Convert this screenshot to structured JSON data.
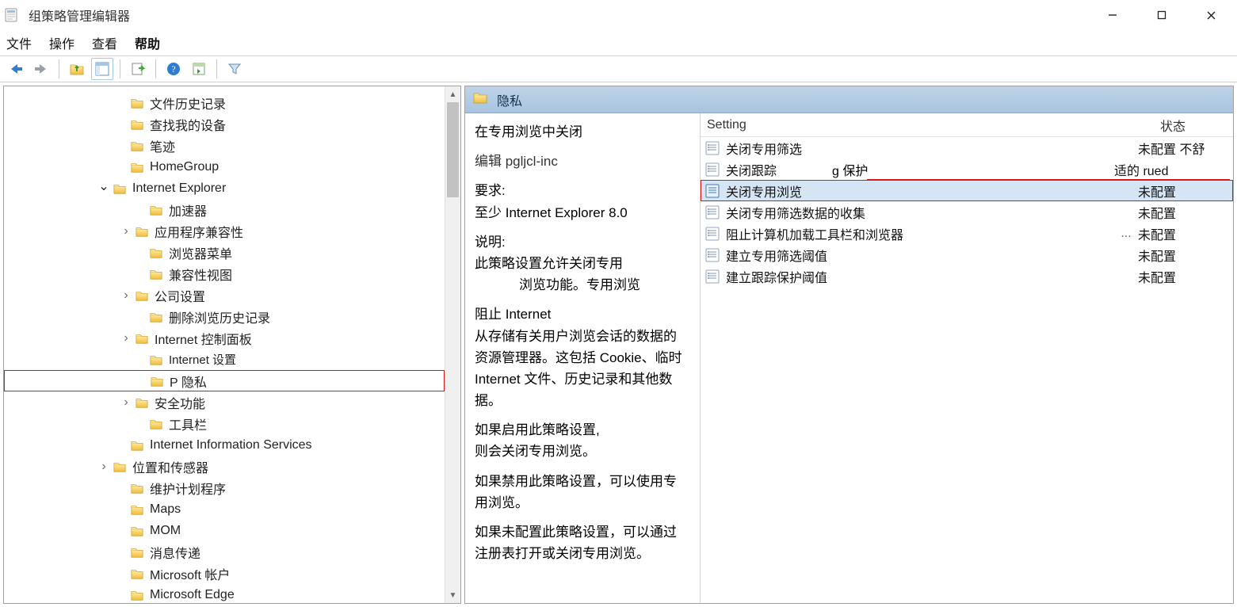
{
  "window": {
    "title": "组策略管理编辑器"
  },
  "menu": {
    "file": "文件",
    "action": "操作",
    "view": "查看",
    "help": "帮助"
  },
  "tree": {
    "items": [
      {
        "indent": 140,
        "expander": "",
        "label": "文件历史记录"
      },
      {
        "indent": 140,
        "expander": "",
        "label": "查找我的设备"
      },
      {
        "indent": 140,
        "expander": "",
        "label": "笔迹"
      },
      {
        "indent": 140,
        "expander": "",
        "label": "HomeGroup"
      },
      {
        "indent": 118,
        "expander": "v",
        "label": "Internet Explorer"
      },
      {
        "indent": 164,
        "expander": "",
        "label": "加速器"
      },
      {
        "indent": 146,
        "expander": ">",
        "label": "应用程序兼容性"
      },
      {
        "indent": 164,
        "expander": "",
        "label": "浏览器菜单"
      },
      {
        "indent": 164,
        "expander": "",
        "label": "兼容性视图"
      },
      {
        "indent": 146,
        "expander": ">",
        "label": "公司设置"
      },
      {
        "indent": 164,
        "expander": "",
        "label": "删除浏览历史记录"
      },
      {
        "indent": 146,
        "expander": ">",
        "label": "Internet 控制面板"
      },
      {
        "indent": 164,
        "expander": "",
        "label": "Internet 设置",
        "small": true
      },
      {
        "indent": 164,
        "expander": "",
        "label": "P 隐私",
        "highlight": true
      },
      {
        "indent": 146,
        "expander": ">",
        "label": "安全功能"
      },
      {
        "indent": 164,
        "expander": "",
        "label": "工具栏"
      },
      {
        "indent": 140,
        "expander": "",
        "label": "Internet Information Services"
      },
      {
        "indent": 118,
        "expander": ">",
        "label": "位置和传感器"
      },
      {
        "indent": 140,
        "expander": "",
        "label": "维护计划程序"
      },
      {
        "indent": 140,
        "expander": "",
        "label": "Maps"
      },
      {
        "indent": 140,
        "expander": "",
        "label": "MOM"
      },
      {
        "indent": 140,
        "expander": "",
        "label": "消息传递"
      },
      {
        "indent": 140,
        "expander": "",
        "label": "Microsoft 帐户"
      },
      {
        "indent": 140,
        "expander": "",
        "label": "Microsoft Edge"
      }
    ]
  },
  "right": {
    "header_title": "隐私",
    "columns": {
      "setting": "Setting",
      "state": "状态"
    },
    "details": {
      "title": "在专用浏览中关闭",
      "edit_line": "编辑 pgljcl-inc",
      "req_label": "要求:",
      "req_value": "至少 Internet Explorer 8.0",
      "desc_label": "说明:",
      "p1": "此策略设置允许关闭专用",
      "p1b": "浏览功能。专用浏览",
      "p2": "阻止 Internet",
      "p3": "从存储有关用户浏览会话的数据的资源管理器。这包括 Cookie、临时 Internet 文件、历史记录和其他数据。",
      "p4": "如果启用此策略设置,",
      "p4b": "则会关闭专用浏览。",
      "p5": "如果禁用此策略设置，可以使用专用浏览。",
      "p6": "如果未配置此策略设置，可以通过注册表打开或关闭专用浏览。"
    },
    "settings": [
      {
        "name": "关闭专用筛选",
        "state": "未配置 不舒",
        "icon": "policy"
      },
      {
        "name": "关闭跟踪",
        "state": "适的 rued",
        "icon": "policy",
        "mid": "g 保护",
        "redline": true
      },
      {
        "name": "关闭专用浏览",
        "state": "未配置",
        "icon": "policy-sel",
        "selected": true,
        "highlight": true
      },
      {
        "name": "关闭专用筛选数据的收集",
        "state": "未配置",
        "icon": "policy"
      },
      {
        "name": "阻止计算机加载工具栏和浏览器",
        "state": "未配置",
        "icon": "policy",
        "ellipsis": "..."
      },
      {
        "name": "建立专用筛选阈值",
        "state": "未配置",
        "icon": "policy"
      },
      {
        "name": "建立跟踪保护阈值",
        "state": "未配置",
        "icon": "policy"
      }
    ]
  }
}
